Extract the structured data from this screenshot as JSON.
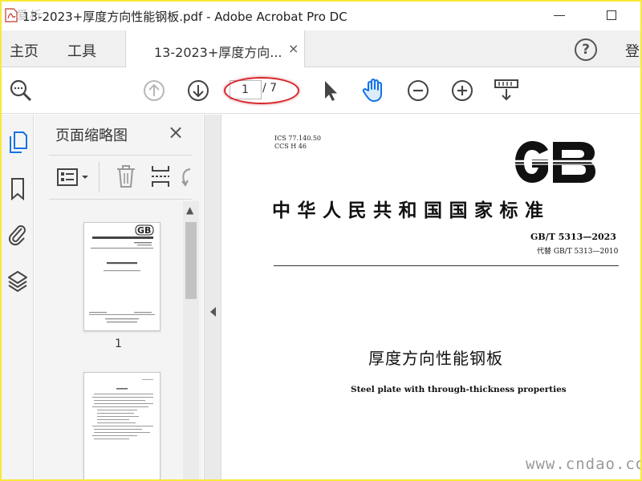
{
  "window": {
    "title": "13-2023+厚度方向性能钢板.pdf - Adobe Acrobat Pro DC",
    "overlay_watermark": "爱析"
  },
  "tabs": {
    "home_label": "主页",
    "tools_label": "工具",
    "document_tab_label": "13-2023+厚度方向...",
    "close_symbol": "×",
    "help_symbol": "?",
    "login_label_partial": "登"
  },
  "toolbar": {
    "icons": [
      "zoom-search-icon",
      "page-up-icon",
      "page-down-icon",
      "select-cursor-icon",
      "hand-tool-icon",
      "zoom-out-icon",
      "zoom-in-icon",
      "fit-page-icon"
    ],
    "current_page": "1",
    "total_pages": "/ 7",
    "highlight_color": "#d8262a"
  },
  "left_rail": {
    "icons": [
      "page-thumbnails-icon",
      "bookmark-icon",
      "attachment-icon",
      "layers-icon"
    ],
    "active_color": "#1473e6"
  },
  "thumbnail_panel": {
    "title": "页面缩略图",
    "close_symbol": "×",
    "tool_icons": [
      "options-menu-icon",
      "delete-icon",
      "insert-page-icon",
      "rotate-icon"
    ],
    "thumbnails": [
      {
        "page_label": "1"
      }
    ]
  },
  "document": {
    "ics_line": "ICS 77.140.50",
    "ccs_line": "CCS H 46",
    "gb_logo_text": "GB",
    "standard_title": "中华人民共和国国家标准",
    "standard_code": "GB/T 5313—2023",
    "replaces": "代替 GB/T 5313—2010",
    "chinese_name": "厚度方向性能钢板",
    "english_name": "Steel plate with through-thickness properties"
  },
  "site_watermark": "www.cndao.com"
}
